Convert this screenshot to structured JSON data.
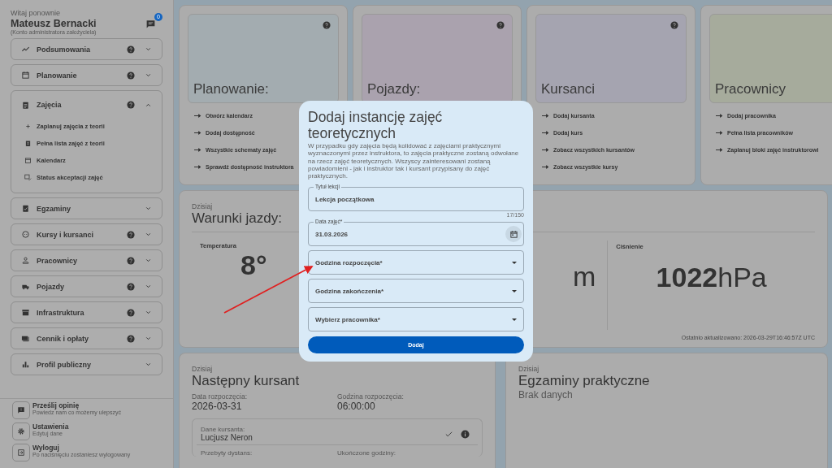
{
  "sidebar": {
    "greeting": "Witaj ponownie",
    "user_name": "Mateusz Bernacki",
    "account_type": "(Konto administratora założyciela)",
    "notifications_badge": "0",
    "items": [
      {
        "label": "Podsumowania",
        "help": true,
        "expanded": false
      },
      {
        "label": "Planowanie",
        "help": true,
        "expanded": false
      },
      {
        "label": "Zajęcia",
        "help": true,
        "expanded": true,
        "children": [
          "Zaplanuj zajęcia z teorii",
          "Pełna lista zajęć z teorii",
          "Kalendarz",
          "Status akceptacji zajęć"
        ]
      },
      {
        "label": "Egzaminy",
        "help": false,
        "expanded": false
      },
      {
        "label": "Kursy i kursanci",
        "help": true,
        "expanded": false
      },
      {
        "label": "Pracownicy",
        "help": true,
        "expanded": false
      },
      {
        "label": "Pojazdy",
        "help": true,
        "expanded": false
      },
      {
        "label": "Infrastruktura",
        "help": true,
        "expanded": false
      },
      {
        "label": "Cennik i opłaty",
        "help": true,
        "expanded": false
      },
      {
        "label": "Profil publiczny",
        "help": false,
        "expanded": false
      }
    ],
    "actions": [
      {
        "title": "Prześlij opinię",
        "subtitle": "Powiedz nam co możemy ulepszyć"
      },
      {
        "title": "Ustawienia",
        "subtitle": "Edytuj dane"
      },
      {
        "title": "Wyloguj",
        "subtitle": "Po naciśnięciu zostaniesz wylogowany"
      }
    ]
  },
  "feature_cards": [
    {
      "title": "Planowanie:",
      "help": true,
      "color": "#a3acb0",
      "links": [
        "Otwórz kalendarz",
        "Dodaj dostępność",
        "Wszystkie schematy zajęć",
        "Sprawdź dostępność instruktora"
      ]
    },
    {
      "title": "Pojazdy:",
      "help": true,
      "color": "#aaa2ae"
    },
    {
      "title": "Kursanci",
      "help": true,
      "color": "#a5a4b0",
      "links": [
        "Dodaj kursanta",
        "Dodaj kurs",
        "Zobacz wszystkich kursantów",
        "Zobacz wszystkie kursy"
      ]
    },
    {
      "title": "Pracownicy",
      "help": false,
      "color": "#a6ab9c",
      "links": [
        "Dodaj pracownika",
        "Pełna lista pracowników",
        "Zaplanuj bloki zajęć instruktorowi"
      ]
    }
  ],
  "weather": {
    "caption": "Dzisiaj",
    "title": "Warunki jazdy:",
    "columns": [
      {
        "label": "Temperatura",
        "value": "8°"
      },
      {
        "unit": "m"
      },
      {
        "label": "Ciśnienie",
        "value": "1022",
        "unit": "hPa"
      }
    ],
    "updated": "Ostatnio aktualizowano: 2026-03-29T16:46:57Z UTC"
  },
  "next_student": {
    "caption": "Dzisiaj",
    "title": "Następny kursant",
    "fields": [
      {
        "label": "Data rozpoczęcia:",
        "value": "2026-03-31"
      },
      {
        "label": "Godzina rozpoczęcia:",
        "value": "06:00:00"
      }
    ],
    "student": {
      "label": "Dane kursanta:",
      "name": "Lucjusz Neron",
      "stats": [
        "Przebyty dystans:",
        "Ukończone godziny:"
      ]
    }
  },
  "exams": {
    "caption": "Dzisiaj",
    "title": "Egzaminy praktyczne",
    "empty": "Brak danych"
  },
  "dialog": {
    "title": "Dodaj instancję zajęć teoretycznych",
    "description": "W przypadku gdy zajęcia będą kolidować z zajęciami praktycznymi wyznaczonymi przez instruktora, to zajęcia praktyczne zostaną odwołane na rzecz zajęć teoretycznych. Wszyscy zainteresowani zostaną powiadomieni - jak i instruktor tak i kursant przypisany do zajęć praktycznych.",
    "fields": [
      {
        "kind": "text",
        "label": "Tytuł lekcji",
        "value": "Lekcja początkowa",
        "counter": "17/150"
      },
      {
        "kind": "date",
        "label": "Data zajęć*",
        "value": "31.03.2026"
      },
      {
        "kind": "select",
        "label": "Godzina rozpoczęcia*"
      },
      {
        "kind": "select",
        "label": "Godzina zakończenia*"
      },
      {
        "kind": "select",
        "label": "Wybierz pracownika*"
      }
    ],
    "submit": "Dodaj"
  }
}
